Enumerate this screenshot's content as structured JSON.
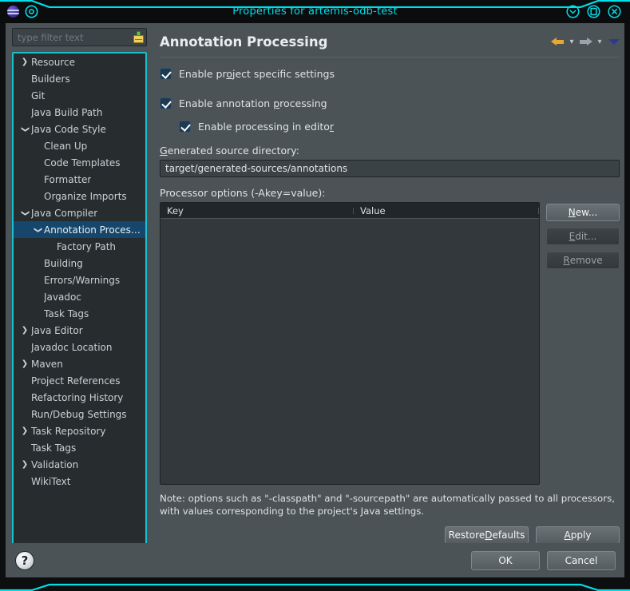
{
  "window": {
    "title": "Properties for artemis-odb-test",
    "app_icon": "eclipse-globe-icon",
    "status_icon": "target-circle-icon",
    "controls": [
      {
        "name": "minimize-button",
        "glyph": "⌄"
      },
      {
        "name": "maximize-button",
        "glyph": "□"
      },
      {
        "name": "close-button",
        "glyph": "✕"
      }
    ]
  },
  "sidebar": {
    "filter": {
      "placeholder": "type filter text",
      "value": "",
      "clear_icon": "broom-icon"
    },
    "scrollbar": {
      "left_arrow": "‹",
      "right_arrow_1": "‹",
      "right_arrow_2": "›"
    },
    "items": [
      {
        "label": "Resource",
        "depth": 0,
        "twisty": "collapsed",
        "selected": false
      },
      {
        "label": "Builders",
        "depth": 0,
        "twisty": "none",
        "selected": false
      },
      {
        "label": "Git",
        "depth": 0,
        "twisty": "none",
        "selected": false
      },
      {
        "label": "Java Build Path",
        "depth": 0,
        "twisty": "none",
        "selected": false
      },
      {
        "label": "Java Code Style",
        "depth": 0,
        "twisty": "expanded",
        "selected": false
      },
      {
        "label": "Clean Up",
        "depth": 1,
        "twisty": "none",
        "selected": false
      },
      {
        "label": "Code Templates",
        "depth": 1,
        "twisty": "none",
        "selected": false
      },
      {
        "label": "Formatter",
        "depth": 1,
        "twisty": "none",
        "selected": false
      },
      {
        "label": "Organize Imports",
        "depth": 1,
        "twisty": "none",
        "selected": false
      },
      {
        "label": "Java Compiler",
        "depth": 0,
        "twisty": "expanded",
        "selected": false
      },
      {
        "label": "Annotation Processing",
        "depth": 1,
        "twisty": "expanded",
        "selected": true
      },
      {
        "label": "Factory Path",
        "depth": 2,
        "twisty": "none",
        "selected": false
      },
      {
        "label": "Building",
        "depth": 1,
        "twisty": "none",
        "selected": false
      },
      {
        "label": "Errors/Warnings",
        "depth": 1,
        "twisty": "none",
        "selected": false
      },
      {
        "label": "Javadoc",
        "depth": 1,
        "twisty": "none",
        "selected": false
      },
      {
        "label": "Task Tags",
        "depth": 1,
        "twisty": "none",
        "selected": false
      },
      {
        "label": "Java Editor",
        "depth": 0,
        "twisty": "collapsed",
        "selected": false
      },
      {
        "label": "Javadoc Location",
        "depth": 0,
        "twisty": "none",
        "selected": false
      },
      {
        "label": "Maven",
        "depth": 0,
        "twisty": "collapsed",
        "selected": false
      },
      {
        "label": "Project References",
        "depth": 0,
        "twisty": "none",
        "selected": false
      },
      {
        "label": "Refactoring History",
        "depth": 0,
        "twisty": "none",
        "selected": false
      },
      {
        "label": "Run/Debug Settings",
        "depth": 0,
        "twisty": "none",
        "selected": false
      },
      {
        "label": "Task Repository",
        "depth": 0,
        "twisty": "collapsed",
        "selected": false
      },
      {
        "label": "Task Tags",
        "depth": 0,
        "twisty": "none",
        "selected": false
      },
      {
        "label": "Validation",
        "depth": 0,
        "twisty": "collapsed",
        "selected": false
      },
      {
        "label": "WikiText",
        "depth": 0,
        "twisty": "none",
        "selected": false
      }
    ]
  },
  "page": {
    "title": "Annotation Processing",
    "nav": {
      "back_icon": "arrow-left-icon",
      "back_menu_icon": "chevron-down-icon",
      "forward_icon": "arrow-right-icon",
      "forward_menu_icon": "chevron-down-icon",
      "view_menu_icon": "triangle-down-icon"
    },
    "checkboxes": [
      {
        "pre": "Enable pr",
        "mn": "o",
        "post": "ject specific settings",
        "checked": true
      },
      {
        "pre": "Enable annotation ",
        "mn": "p",
        "post": "rocessing",
        "checked": true
      },
      {
        "pre": "Enable processing in edito",
        "mn": "r",
        "post": "",
        "checked": true
      }
    ],
    "generated_source": {
      "label_mn": "G",
      "label_rest": "enerated source directory:",
      "value": "target/generated-sources/annotations"
    },
    "processor_options_label": "Processor options (-Akey=value):",
    "table": {
      "columns": [
        "Key",
        "Value"
      ],
      "rows": []
    },
    "side_buttons": [
      {
        "mn": "N",
        "rest": "ew...",
        "enabled": true
      },
      {
        "mn": "E",
        "rest": "dit...",
        "enabled": false
      },
      {
        "mn": "R",
        "rest": "emove",
        "enabled": false
      }
    ],
    "note": "Note: options such as \"-classpath\" and \"-sourcepath\" are automatically passed to all processors, with values corresponding to the project's Java settings.",
    "lower_buttons": [
      {
        "pre": "Restore ",
        "mn": "D",
        "post": "efaults",
        "enabled": true
      },
      {
        "pre": "",
        "mn": "A",
        "post": "pply",
        "enabled": true
      }
    ]
  },
  "footer": {
    "help_icon": "question-mark-icon",
    "buttons": [
      {
        "label": "OK",
        "enabled": true
      },
      {
        "label": "Cancel",
        "enabled": true
      }
    ]
  },
  "colors": {
    "accent_cyan": "#00dfe8",
    "panel_bg": "#4c5357",
    "tree_bg": "#272c2f",
    "selection_blue": "#16466b",
    "checkbox_blue": "#1d3a52",
    "back_arrow_gold": "#e8a72e"
  }
}
